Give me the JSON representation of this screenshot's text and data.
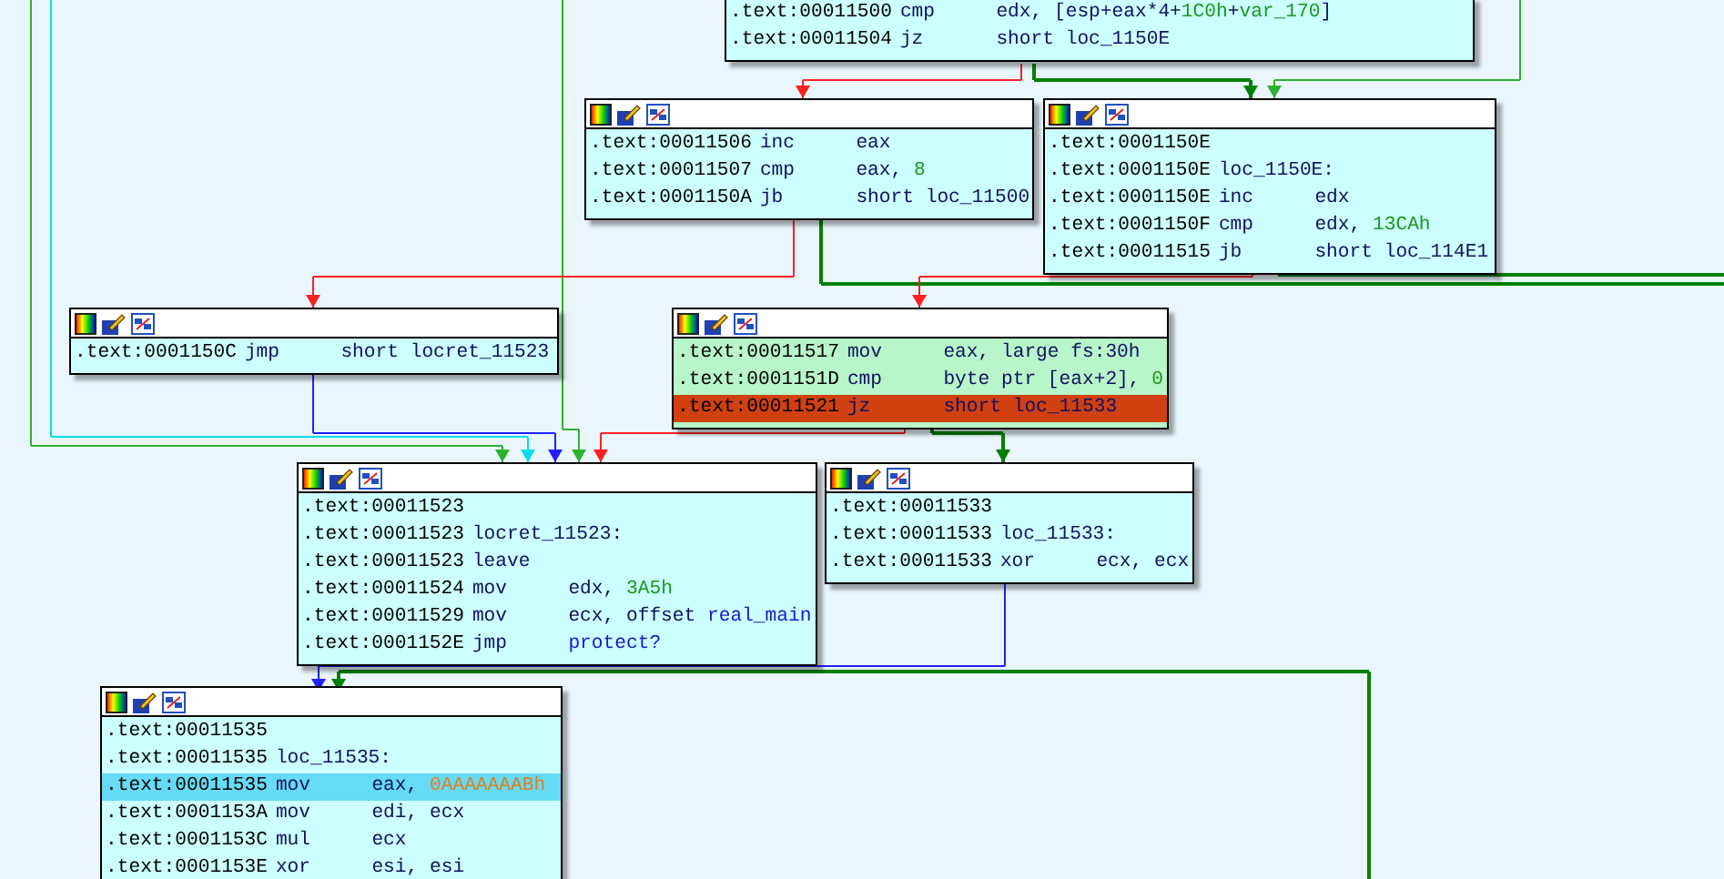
{
  "graph": {
    "blocks": [
      {
        "header": false,
        "color": "#ccffff",
        "lines": [
          {
            "address": ".text:00011500",
            "mnemonic": "cmp",
            "operands": [
              {
                "text": "edx, [esp+eax*4+",
                "kind": "plain"
              },
              {
                "text": "1C0h",
                "kind": "num"
              },
              {
                "text": "+",
                "kind": "plain"
              },
              {
                "text": "var_170",
                "kind": "num"
              },
              {
                "text": "]",
                "kind": "plain"
              }
            ],
            "selected": false,
            "breakpoint": false
          },
          {
            "address": ".text:00011504",
            "mnemonic": "jz",
            "operands": [
              {
                "text": "short loc_1150E",
                "kind": "plain"
              }
            ],
            "selected": false,
            "breakpoint": false
          }
        ]
      },
      {
        "header": true,
        "color": "#ccffff",
        "lines": [
          {
            "address": ".text:00011506",
            "mnemonic": "inc",
            "operands": [
              {
                "text": "eax",
                "kind": "plain"
              }
            ],
            "selected": false,
            "breakpoint": false
          },
          {
            "address": ".text:00011507",
            "mnemonic": "cmp",
            "operands": [
              {
                "text": "eax, ",
                "kind": "plain"
              },
              {
                "text": "8",
                "kind": "num"
              }
            ],
            "selected": false,
            "breakpoint": false
          },
          {
            "address": ".text:0001150A",
            "mnemonic": "jb",
            "operands": [
              {
                "text": "short loc_11500",
                "kind": "plain"
              }
            ],
            "selected": false,
            "breakpoint": false
          }
        ]
      },
      {
        "header": true,
        "color": "#ccffff",
        "lines": [
          {
            "address": ".text:0001150E",
            "selected": false,
            "breakpoint": false
          },
          {
            "address": ".text:0001150E",
            "mnemonic": "loc_1150E:",
            "selected": false,
            "breakpoint": false
          },
          {
            "address": ".text:0001150E",
            "mnemonic": "inc",
            "operands": [
              {
                "text": "edx",
                "kind": "plain"
              }
            ],
            "selected": false,
            "breakpoint": false
          },
          {
            "address": ".text:0001150F",
            "mnemonic": "cmp",
            "operands": [
              {
                "text": "edx, ",
                "kind": "plain"
              },
              {
                "text": "13CAh",
                "kind": "num"
              }
            ],
            "selected": false,
            "breakpoint": false
          },
          {
            "address": ".text:00011515",
            "mnemonic": "jb",
            "operands": [
              {
                "text": "short loc_114E1",
                "kind": "plain"
              }
            ],
            "selected": false,
            "breakpoint": false
          }
        ]
      },
      {
        "header": true,
        "color": "#ccffff",
        "lines": [
          {
            "address": ".text:0001150C",
            "mnemonic": "jmp",
            "operands": [
              {
                "text": "short locret_11523",
                "kind": "plain"
              }
            ],
            "selected": false,
            "breakpoint": false
          }
        ]
      },
      {
        "header": true,
        "color": "#b8f5c8",
        "lines": [
          {
            "address": ".text:00011517",
            "mnemonic": "mov",
            "operands": [
              {
                "text": "eax, large fs:30h",
                "kind": "plain"
              }
            ],
            "selected": false,
            "breakpoint": false
          },
          {
            "address": ".text:0001151D",
            "mnemonic": "cmp",
            "operands": [
              {
                "text": "byte ptr [eax+2], ",
                "kind": "plain"
              },
              {
                "text": "0",
                "kind": "num"
              }
            ],
            "selected": false,
            "breakpoint": false
          },
          {
            "address": ".text:00011521",
            "mnemonic": "jz",
            "operands": [
              {
                "text": "short loc_11533",
                "kind": "plain"
              }
            ],
            "selected": false,
            "breakpoint": true
          }
        ]
      },
      {
        "header": true,
        "color": "#ccffff",
        "lines": [
          {
            "address": ".text:00011523",
            "selected": false,
            "breakpoint": false
          },
          {
            "address": ".text:00011523",
            "mnemonic": "locret_11523:",
            "selected": false,
            "breakpoint": false
          },
          {
            "address": ".text:00011523",
            "mnemonic": "leave",
            "selected": false,
            "breakpoint": false
          },
          {
            "address": ".text:00011524",
            "mnemonic": "mov",
            "operands": [
              {
                "text": "edx, ",
                "kind": "plain"
              },
              {
                "text": "3A5h",
                "kind": "num"
              }
            ],
            "selected": false,
            "breakpoint": false
          },
          {
            "address": ".text:00011529",
            "mnemonic": "mov",
            "operands": [
              {
                "text": "ecx, offset ",
                "kind": "plain"
              },
              {
                "text": "real_main",
                "kind": "name"
              }
            ],
            "selected": false,
            "breakpoint": false
          },
          {
            "address": ".text:0001152E",
            "mnemonic": "jmp",
            "operands": [
              {
                "text": "protect?",
                "kind": "name"
              }
            ],
            "selected": false,
            "breakpoint": false
          }
        ]
      },
      {
        "header": true,
        "color": "#ccffff",
        "lines": [
          {
            "address": ".text:00011533",
            "selected": false,
            "breakpoint": false
          },
          {
            "address": ".text:00011533",
            "mnemonic": "loc_11533:",
            "selected": false,
            "breakpoint": false
          },
          {
            "address": ".text:00011533",
            "mnemonic": "xor",
            "operands": [
              {
                "text": "ecx, ecx",
                "kind": "plain"
              }
            ],
            "selected": false,
            "breakpoint": false
          }
        ]
      },
      {
        "header": true,
        "color": "#ccffff",
        "lines": [
          {
            "address": ".text:00011535",
            "selected": false,
            "breakpoint": false
          },
          {
            "address": ".text:00011535",
            "mnemonic": "loc_11535:",
            "selected": false,
            "breakpoint": false
          },
          {
            "address": ".text:00011535",
            "mnemonic": "mov",
            "operands": [
              {
                "text": "eax, ",
                "kind": "plain"
              },
              {
                "text": "0AAAAAAABh",
                "kind": "imm"
              }
            ],
            "selected": true,
            "breakpoint": false
          },
          {
            "address": ".text:0001153A",
            "mnemonic": "mov",
            "operands": [
              {
                "text": "edi, ecx",
                "kind": "plain"
              }
            ],
            "selected": false,
            "breakpoint": false
          },
          {
            "address": ".text:0001153C",
            "mnemonic": "mul",
            "operands": [
              {
                "text": "ecx",
                "kind": "plain"
              }
            ],
            "selected": false,
            "breakpoint": false
          },
          {
            "address": ".text:0001153E",
            "mnemonic": "xor",
            "operands": [
              {
                "text": "esi, esi",
                "kind": "plain"
              }
            ],
            "selected": false,
            "breakpoint": false
          }
        ]
      }
    ]
  }
}
